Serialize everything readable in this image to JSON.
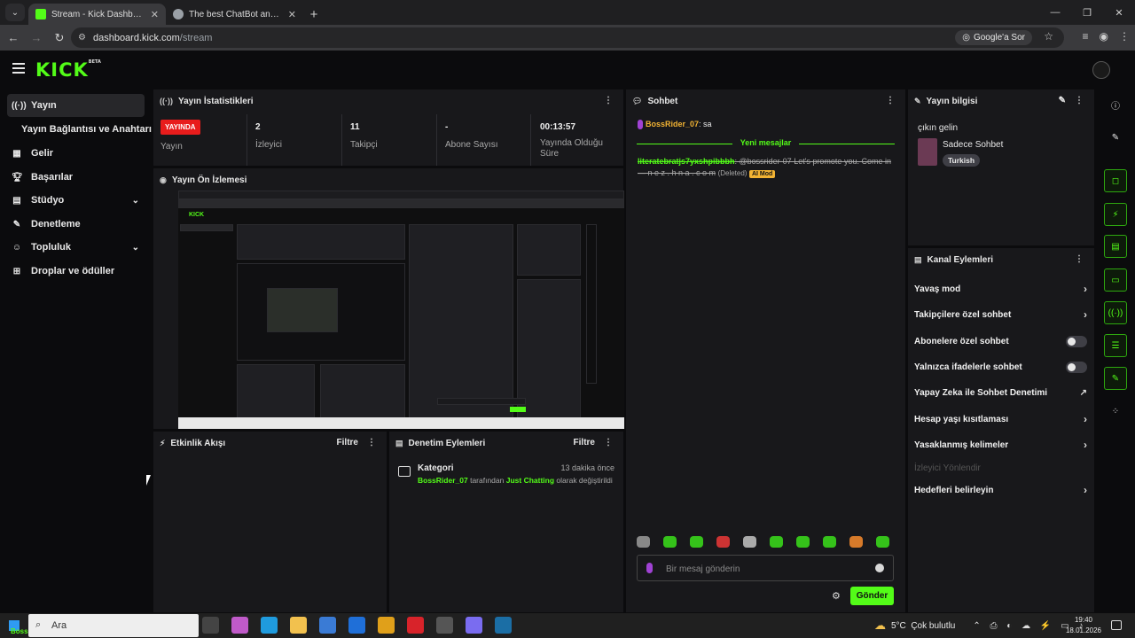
{
  "browser": {
    "tabs": [
      {
        "title": "Stream - Kick Dashboard",
        "active": true
      },
      {
        "title": "The best ChatBot and Widgets",
        "active": false
      }
    ],
    "url_host": "dashboard.kick.com",
    "url_path": "/stream",
    "google_sor": "Google'a Sor"
  },
  "logo": {
    "text": "KICK",
    "beta": "BETA"
  },
  "sidebar": {
    "items": [
      {
        "label": "Yayın",
        "icon": "broadcast-icon"
      },
      {
        "label": "Yayın Bağlantısı ve Anahtarı",
        "icon": ""
      },
      {
        "label": "Gelir",
        "icon": "revenue-icon"
      },
      {
        "label": "Başarılar",
        "icon": "trophy-icon"
      },
      {
        "label": "Stüdyo",
        "icon": "studio-icon"
      },
      {
        "label": "Denetleme",
        "icon": "wrench-icon"
      },
      {
        "label": "Topluluk",
        "icon": "community-icon"
      },
      {
        "label": "Droplar ve ödüller",
        "icon": "drops-icon"
      }
    ]
  },
  "stats": {
    "title": "Yayın İstatistikleri",
    "live_badge": "YAYINDA",
    "items": [
      {
        "value": "",
        "label": "Yayın"
      },
      {
        "value": "2",
        "label": "İzleyici"
      },
      {
        "value": "11",
        "label": "Takipçi"
      },
      {
        "value": "-",
        "label": "Abone Sayısı"
      },
      {
        "value": "00:13:57",
        "label": "Yayında Olduğu Süre"
      }
    ]
  },
  "preview": {
    "title": "Yayın Ön İzlemesi"
  },
  "activity": {
    "title": "Etkinlik Akışı",
    "filter": "Filtre"
  },
  "moderation": {
    "title": "Denetim Eylemleri",
    "filter": "Filtre",
    "entry": {
      "heading": "Kategori",
      "time": "13 dakika önce",
      "user": "BossRider_07",
      "text1": "tarafından",
      "category": "Just Chatting",
      "text2": "olarak değiştirildi"
    }
  },
  "chat": {
    "title": "Sohbet",
    "msg1_user": "BossRider_07",
    "msg1_text": ": sa",
    "new_messages": "Yeni mesajlar",
    "msg2_user": "literatebratjs7yxshpibbbh",
    "msg2_text": ": @bossrider-07 Let's promote you. Come in — n e z . h n a . c o m",
    "msg2_deleted": "(Deleted)",
    "msg2_badge": "AI Mod",
    "input_placeholder": "Bir mesaj gönderin",
    "send_label": "Gönder"
  },
  "stream_info": {
    "title": "Yayın bilgisi",
    "stream_title": "çıkın gelin",
    "category": "Sadece Sohbet",
    "tag": "Turkish"
  },
  "channel_actions": {
    "title": "Kanal Eylemleri",
    "items": [
      {
        "label": "Yavaş mod",
        "type": "chevron"
      },
      {
        "label": "Takipçilere özel sohbet",
        "type": "chevron"
      },
      {
        "label": "Abonelere özel sohbet",
        "type": "toggle"
      },
      {
        "label": "Yalnızca ifadelerle sohbet",
        "type": "toggle"
      },
      {
        "label": "Yapay Zeka ile Sohbet Denetimi",
        "type": "external"
      },
      {
        "label": "Hesap yaşı kısıtlaması",
        "type": "chevron"
      },
      {
        "label": "Yasaklanmış kelimeler",
        "type": "chevron"
      },
      {
        "label": "İzleyici Yönlendir",
        "type": "disabled"
      },
      {
        "label": "Hedefleri belirleyin",
        "type": "chevron"
      }
    ]
  },
  "taskbar": {
    "search": "Ara",
    "user_label": "BossRider_07",
    "weather": "5°C  Çok bulutlu",
    "time": "19:40",
    "date": "18.01.2026"
  },
  "colors": {
    "accent": "#53fc18",
    "live": "#e81c1c",
    "panel": "#18181b"
  }
}
